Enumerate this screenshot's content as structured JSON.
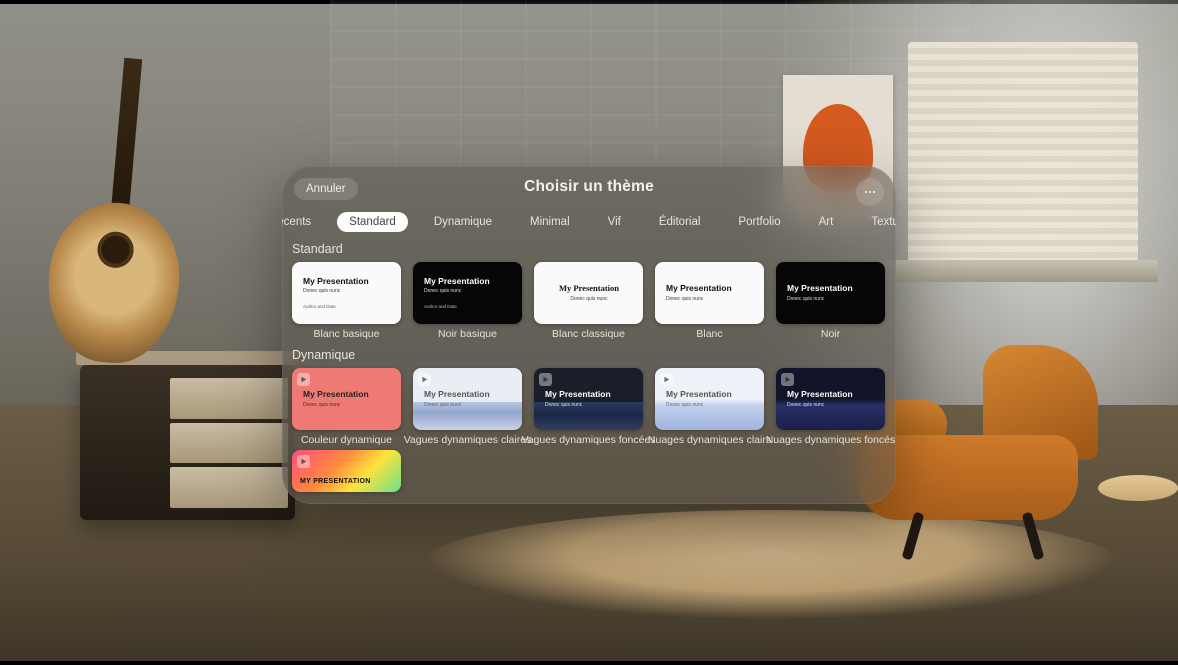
{
  "header": {
    "cancel": "Annuler",
    "title": "Choisir un thème"
  },
  "tabs": [
    "Récents",
    "Standard",
    "Dynamique",
    "Minimal",
    "Vif",
    "Éditorial",
    "Portfolio",
    "Art",
    "Texturé"
  ],
  "activeTab": "Standard",
  "sections": {
    "standard": {
      "title": "Standard",
      "items": [
        {
          "label": "Blanc basique",
          "heading": "My Presentation",
          "sub": "Donec quis nunc",
          "author": "Author and Date",
          "style": "bg-white"
        },
        {
          "label": "Noir basique",
          "heading": "My Presentation",
          "sub": "Donec quis nunc",
          "author": "Author and Date",
          "style": "bg-black"
        },
        {
          "label": "Blanc classique",
          "heading": "My Presentation",
          "sub": "Donec quis nunc",
          "author": "",
          "style": "bg-white center"
        },
        {
          "label": "Blanc",
          "heading": "My Presentation",
          "sub": "Donec quis nunc",
          "author": "",
          "style": "bg-white"
        },
        {
          "label": "Noir",
          "heading": "My Presentation",
          "sub": "Donec quis nunc",
          "author": "",
          "style": "bg-black"
        }
      ]
    },
    "dynamique": {
      "title": "Dynamique",
      "items": [
        {
          "label": "Couleur dynamique",
          "heading": "My Presentation",
          "sub": "Donec quis nunc",
          "style": "bg-coral",
          "play": true
        },
        {
          "label": "Vagues dynamiques claires",
          "heading": "My Presentation",
          "sub": "Donec quis nunc",
          "style": "bg-wave-light",
          "play": true
        },
        {
          "label": "Vagues dynamiques foncées",
          "heading": "My Presentation",
          "sub": "Donec quis nunc",
          "style": "bg-wave-dark",
          "play": true
        },
        {
          "label": "Nuages dynamiques clairs",
          "heading": "My Presentation",
          "sub": "Donec quis nunc",
          "style": "bg-cloud-light",
          "play": true
        },
        {
          "label": "Nuages dynamiques foncés",
          "heading": "My Presentation",
          "sub": "Donec quis nunc",
          "style": "bg-cloud-dark",
          "play": true
        }
      ],
      "extra": {
        "heading": "MY PRESENTATION",
        "style": "bg-gradient",
        "play": true
      }
    }
  }
}
